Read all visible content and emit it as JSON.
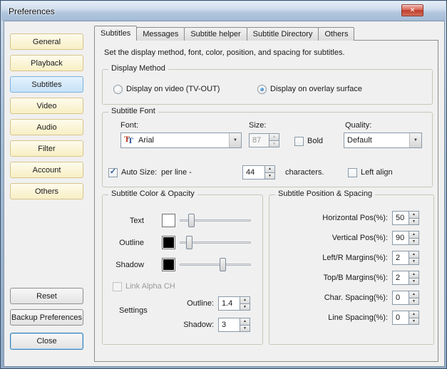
{
  "window": {
    "title": "Preferences"
  },
  "icons": {
    "close": "✕",
    "dropdown": "▼",
    "spin_up": "▲",
    "spin_down": "▼",
    "check": "✓",
    "truetype": "T"
  },
  "sidebar": {
    "items": [
      {
        "label": "General"
      },
      {
        "label": "Playback"
      },
      {
        "label": "Subtitles"
      },
      {
        "label": "Video"
      },
      {
        "label": "Audio"
      },
      {
        "label": "Filter"
      },
      {
        "label": "Account"
      },
      {
        "label": "Others"
      }
    ],
    "reset": "Reset",
    "backup": "Backup Preferences",
    "close": "Close"
  },
  "tabs": [
    {
      "label": "Subtitles"
    },
    {
      "label": "Messages"
    },
    {
      "label": "Subtitle helper"
    },
    {
      "label": "Subtitle Directory"
    },
    {
      "label": "Others"
    }
  ],
  "description": "Set the display method, font, color, position, and spacing for subtitles.",
  "display_method": {
    "title": "Display Method",
    "option_video": "Display on video (TV-OUT)",
    "option_overlay": "Display on overlay surface"
  },
  "subtitle_font": {
    "title": "Subtitle Font",
    "font_label": "Font:",
    "font_value": "Arial",
    "size_label": "Size:",
    "size_value": "87",
    "bold_label": "Bold",
    "quality_label": "Quality:",
    "quality_value": "Default",
    "auto_size_label": "Auto Size:",
    "per_line_label": "per line -",
    "per_line_value": "44",
    "characters_label": "characters.",
    "left_align_label": "Left align"
  },
  "color_opacity": {
    "title": "Subtitle Color & Opacity",
    "text_label": "Text",
    "outline_label": "Outline",
    "shadow_label": "Shadow",
    "text_color": "#ffffff",
    "outline_color": "#000000",
    "shadow_color": "#000000",
    "link_alpha_label": "Link Alpha CH",
    "settings_label": "Settings",
    "outline_setting_label": "Outline:",
    "outline_setting_value": "1.4",
    "shadow_setting_label": "Shadow:",
    "shadow_setting_value": "3"
  },
  "position_spacing": {
    "title": "Subtitle Position & Spacing",
    "rows": [
      {
        "label": "Horizontal Pos(%):",
        "value": "50"
      },
      {
        "label": "Vertical Pos(%):",
        "value": "90"
      },
      {
        "label": "Left/R Margins(%):",
        "value": "2"
      },
      {
        "label": "Top/B Margins(%):",
        "value": "2"
      },
      {
        "label": "Char. Spacing(%):",
        "value": "0"
      },
      {
        "label": "Line Spacing(%):",
        "value": "0"
      }
    ]
  }
}
